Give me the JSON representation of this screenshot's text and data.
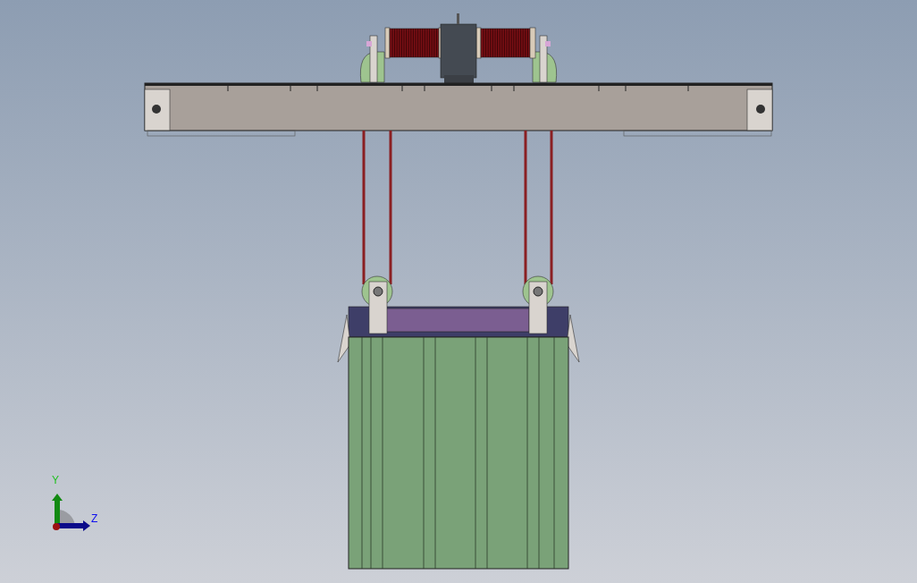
{
  "triad": {
    "axes": [
      {
        "kind": "y",
        "label": "Y"
      },
      {
        "kind": "z",
        "label": "Z"
      }
    ]
  }
}
